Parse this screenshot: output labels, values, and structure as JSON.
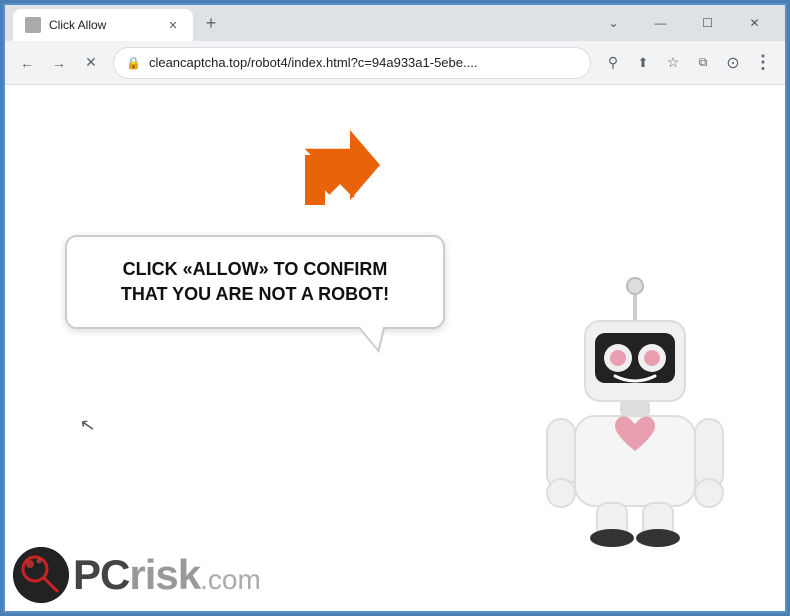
{
  "browser": {
    "title": "Click Allow",
    "url": "cleancaptcha.top/robot4/index.html?c=94a933a1-5ebe....",
    "tab_label": "Click Allow",
    "new_tab_label": "+",
    "window_controls": {
      "minimize": "—",
      "maximize": "☐",
      "close": "✕"
    }
  },
  "nav": {
    "back_label": "←",
    "forward_label": "→",
    "reload_label": "✕",
    "search_icon": "🔍"
  },
  "page": {
    "bubble_text": "CLICK «ALLOW» TO CONFIRM THAT YOU ARE NOT A ROBOT!",
    "watermark_text": "PCrisk.com"
  },
  "icons": {
    "lock": "🔒",
    "search": "⚲",
    "share": "⬆",
    "bookmark": "☆",
    "split": "⧉",
    "profile": "⊙",
    "menu": "⋮",
    "chevron_down": "⌄"
  }
}
